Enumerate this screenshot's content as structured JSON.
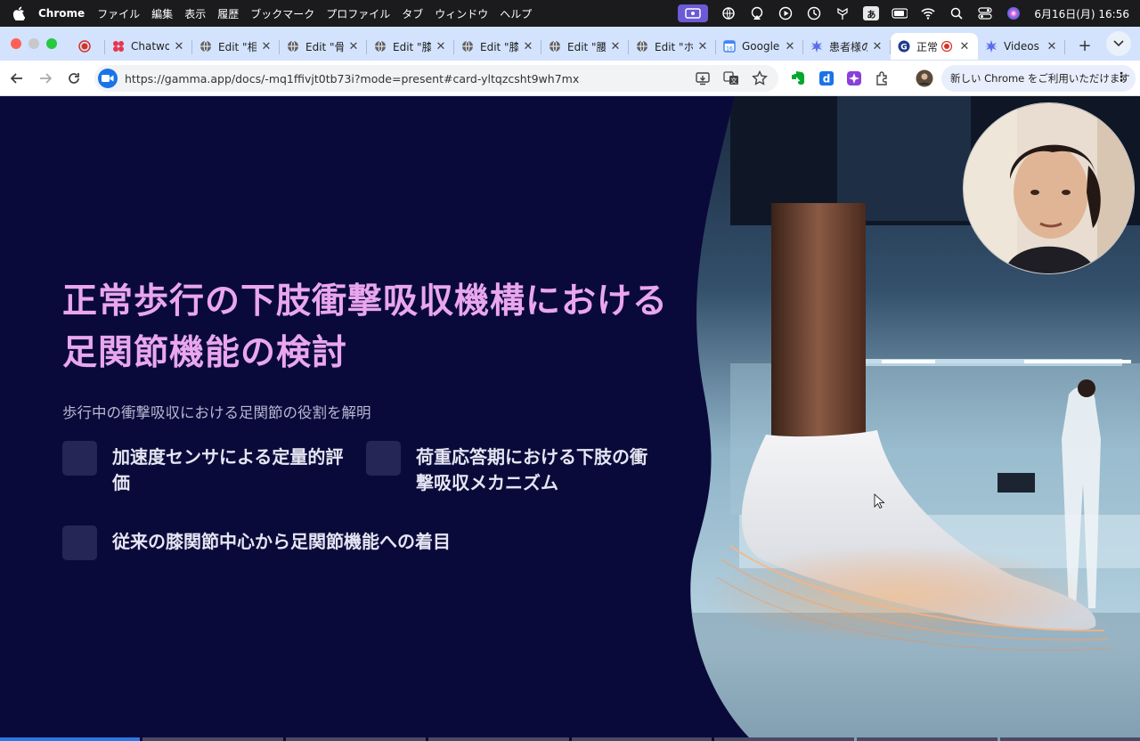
{
  "menubar": {
    "app": "Chrome",
    "items": [
      "ファイル",
      "編集",
      "表示",
      "履歴",
      "ブックマーク",
      "プロファイル",
      "タブ",
      "ウィンドウ",
      "ヘルプ"
    ],
    "ime": "あ",
    "clock": "6月16日(月)  16:56"
  },
  "tabs": [
    {
      "title": "",
      "icon": "record-icon"
    },
    {
      "title": "Chatwo",
      "icon": "chatwoot-icon"
    },
    {
      "title": "Edit \"相",
      "icon": "globe-icon"
    },
    {
      "title": "Edit \"骨",
      "icon": "globe-icon"
    },
    {
      "title": "Edit \"膝",
      "icon": "globe-icon"
    },
    {
      "title": "Edit \"膝",
      "icon": "globe-icon"
    },
    {
      "title": "Edit \"腰",
      "icon": "globe-icon"
    },
    {
      "title": "Edit \"ホ",
      "icon": "globe-icon"
    },
    {
      "title": "Google",
      "icon": "google-calendar-icon"
    },
    {
      "title": "患者様の",
      "icon": "sparkle-icon"
    },
    {
      "title": "正常",
      "icon": "gamma-icon",
      "active": true
    },
    {
      "title": "Videos",
      "icon": "sparkle-icon"
    }
  ],
  "toolbar": {
    "url": "https://gamma.app/docs/-mq1ffivjt0tb73i?mode=present#card-yltqzcsht9wh7mx",
    "update_label": "新しい Chrome をご利用いただけます"
  },
  "slide": {
    "title": "正常歩行の下肢衝撃吸収機構における足関節機能の検討",
    "subtitle": "歩行中の衝撃吸収における足関節の役割を解明",
    "bullets": [
      "加速度センサによる定量的評価",
      "荷重応答期における下肢の衝撃吸収メカニズム",
      "従来の膝関節中心から足関節機能への着目"
    ]
  },
  "colors": {
    "slide_bg": "#0a0a3a",
    "title": "#e9a6ef",
    "accent": "#2b78e4"
  }
}
